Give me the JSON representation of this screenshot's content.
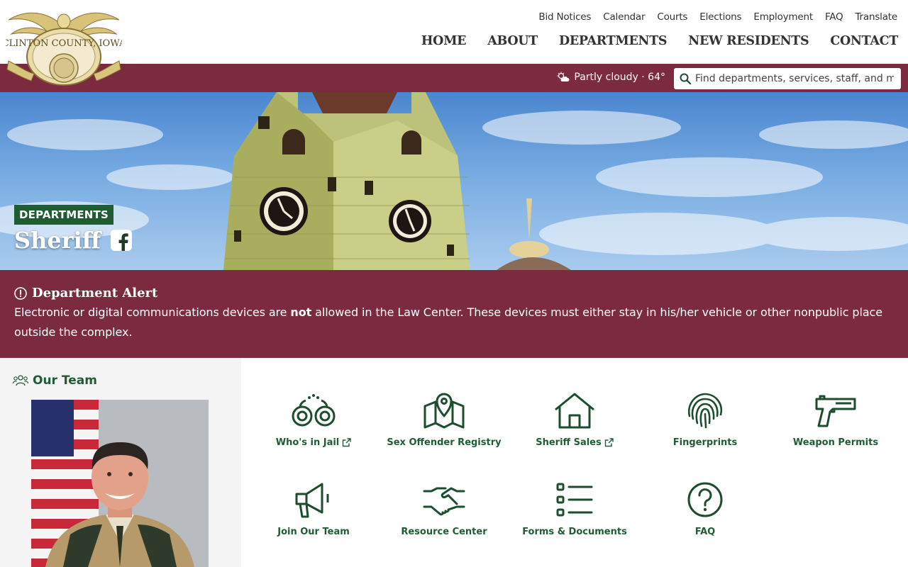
{
  "header": {
    "logo_text": "CLINTON COUNTY, IOWA",
    "utility_nav": [
      "Bid Notices",
      "Calendar",
      "Courts",
      "Elections",
      "Employment",
      "FAQ",
      "Translate"
    ],
    "main_nav": [
      "HOME",
      "ABOUT",
      "DEPARTMENTS",
      "NEW RESIDENTS",
      "CONTACT"
    ]
  },
  "topbar": {
    "weather": "Partly cloudy · 64°",
    "weather_icon": "partly-cloudy-icon",
    "search_placeholder": "Find departments, services, staff, and more"
  },
  "hero": {
    "tag": "DEPARTMENTS",
    "title": "Sheriff"
  },
  "alert": {
    "title": "Department Alert",
    "text_before": "Electronic or digital communications devices are ",
    "text_bold": "not",
    "text_after": " allowed in the Law Center. These devices must either stay in his/her vehicle or other nonpublic place outside the complex."
  },
  "team": {
    "title": "Our Team"
  },
  "services": [
    {
      "label": "Who's in Jail",
      "icon": "handcuffs-icon",
      "external": true
    },
    {
      "label": "Sex Offender Registry",
      "icon": "map-pin-icon",
      "external": false
    },
    {
      "label": "Sheriff Sales",
      "icon": "house-icon",
      "external": true
    },
    {
      "label": "Fingerprints",
      "icon": "fingerprint-icon",
      "external": false
    },
    {
      "label": "Weapon Permits",
      "icon": "pistol-icon",
      "external": false
    },
    {
      "label": "Join Our Team",
      "icon": "megaphone-icon",
      "external": false
    },
    {
      "label": "Resource Center",
      "icon": "handshake-icon",
      "external": false
    },
    {
      "label": "Forms & Documents",
      "icon": "list-icon",
      "external": false
    },
    {
      "label": "FAQ",
      "icon": "question-icon",
      "external": false
    }
  ],
  "colors": {
    "maroon": "#7c2a40",
    "green": "#1f5c34",
    "icon_green": "#1b4d2e"
  }
}
